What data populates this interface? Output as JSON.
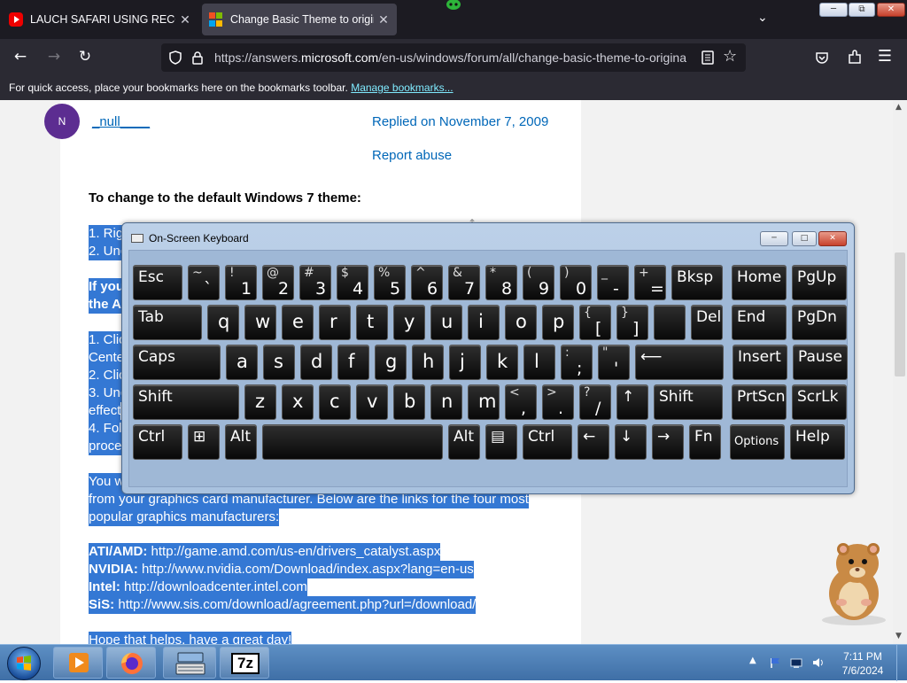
{
  "browser": {
    "tabs": [
      {
        "title": "LAUCH SAFARI USING RECOVER",
        "favicon": "youtube-icon"
      },
      {
        "title": "Change Basic Theme to origina",
        "favicon": "microsoft-icon",
        "active": true
      }
    ],
    "url_prefix": "https://answers.",
    "url_domain": "microsoft.com",
    "url_rest": "/en-us/windows/forum/all/change-basic-theme-to-origina",
    "bookmarks_text": "For quick access, place your bookmarks here on the bookmarks toolbar.",
    "manage_bookmarks": "Manage bookmarks..."
  },
  "post": {
    "avatar_initial": "N",
    "username": "_null____",
    "replied": "Replied on November 7, 2009",
    "report": "Report abuse",
    "heading": "To change to the default Windows 7 theme:",
    "lines": [
      "1. Rig",
      "2. Unc",
      "If you",
      "the A",
      "1. Clic",
      "Cente",
      "2. Clic",
      "3. Unc",
      "effect",
      "4. Fol",
      "proce",
      "You w",
      "from your graphics card manufacturer. Below are the links for the four most",
      "popular graphics manufacturers:"
    ],
    "links": [
      {
        "label": "ATI/AMD:",
        "url": "http://game.amd.com/us-en/drivers_catalyst.aspx"
      },
      {
        "label": "NVIDIA:",
        "url": "http://www.nvidia.com/Download/index.aspx?lang=en-us"
      },
      {
        "label": "Intel:",
        "url": "http://downloadcenter.intel.com"
      },
      {
        "label": "SiS:",
        "url": "http://www.sis.com/download/agreement.php?url=/download/"
      }
    ],
    "closing": "Hope that helps, have a great day!"
  },
  "osk": {
    "title": "On-Screen Keyboard"
  },
  "taskbar": {
    "time": "7:11 PM",
    "date": "7/6/2024",
    "seven_zip": "7z"
  }
}
